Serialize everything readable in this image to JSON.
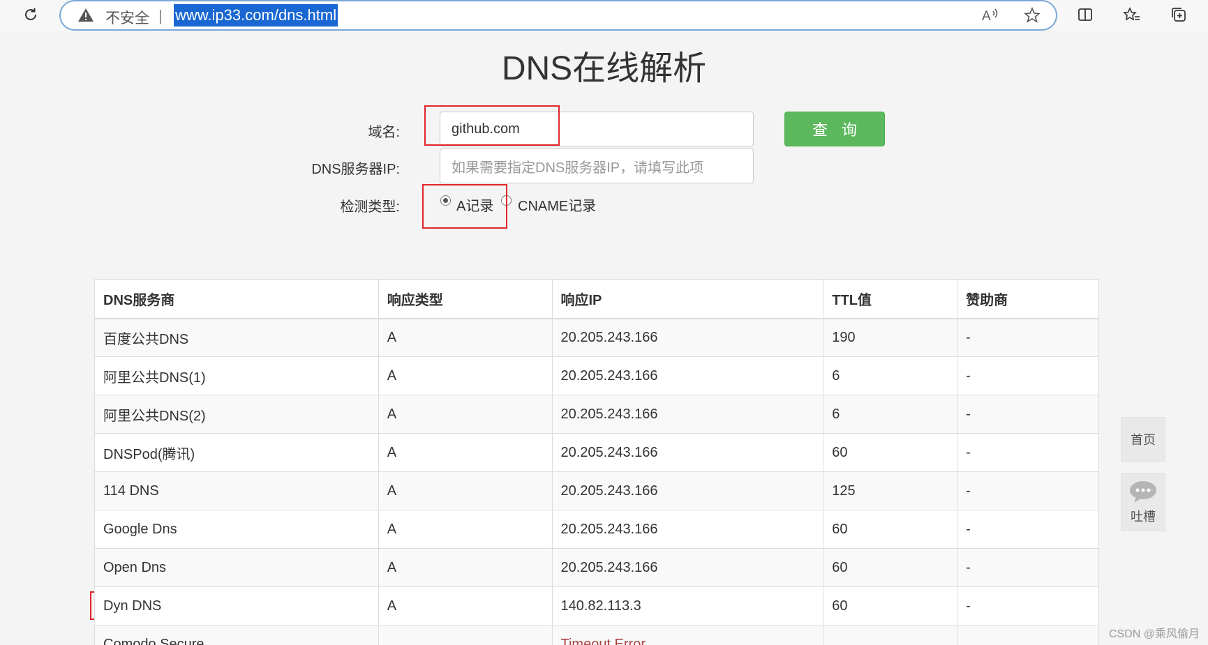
{
  "browser": {
    "security_label": "不安全",
    "separator": "|",
    "url": "www.ip33.com/dns.html"
  },
  "page": {
    "title": "DNS在线解析"
  },
  "form": {
    "domain_label": "域名:",
    "domain_value": "github.com",
    "dns_server_label": "DNS服务器IP:",
    "dns_server_placeholder": "如果需要指定DNS服务器IP，请填写此项",
    "type_label": "检测类型:",
    "type_options": [
      "A记录",
      "CNAME记录"
    ],
    "type_selected": "A记录",
    "query_button": "查询"
  },
  "table": {
    "headers": [
      "DNS服务商",
      "响应类型",
      "响应IP",
      "TTL值",
      "赞助商"
    ],
    "rows": [
      [
        "百度公共DNS",
        "A",
        "20.205.243.166",
        "190",
        "-"
      ],
      [
        "阿里公共DNS(1)",
        "A",
        "20.205.243.166",
        "6",
        "-"
      ],
      [
        "阿里公共DNS(2)",
        "A",
        "20.205.243.166",
        "6",
        "-"
      ],
      [
        "DNSPod(腾讯)",
        "A",
        "20.205.243.166",
        "60",
        "-"
      ],
      [
        "114 DNS",
        "A",
        "20.205.243.166",
        "125",
        "-"
      ],
      [
        "Google Dns",
        "A",
        "20.205.243.166",
        "60",
        "-"
      ],
      [
        "Open Dns",
        "A",
        "20.205.243.166",
        "60",
        "-"
      ],
      [
        "Dyn DNS",
        "A",
        "140.82.113.3",
        "60",
        "-"
      ],
      [
        "Comodo Secure",
        "",
        "Timeout Error",
        "",
        ""
      ]
    ]
  },
  "side": {
    "home": "首页",
    "feedback": "吐槽"
  },
  "watermark": "CSDN @乘风偷月",
  "colors": {
    "accent_red": "#e0262a",
    "button_green": "#5cb85c",
    "url_highlight": "#1967d2",
    "error_text": "#a94442"
  }
}
